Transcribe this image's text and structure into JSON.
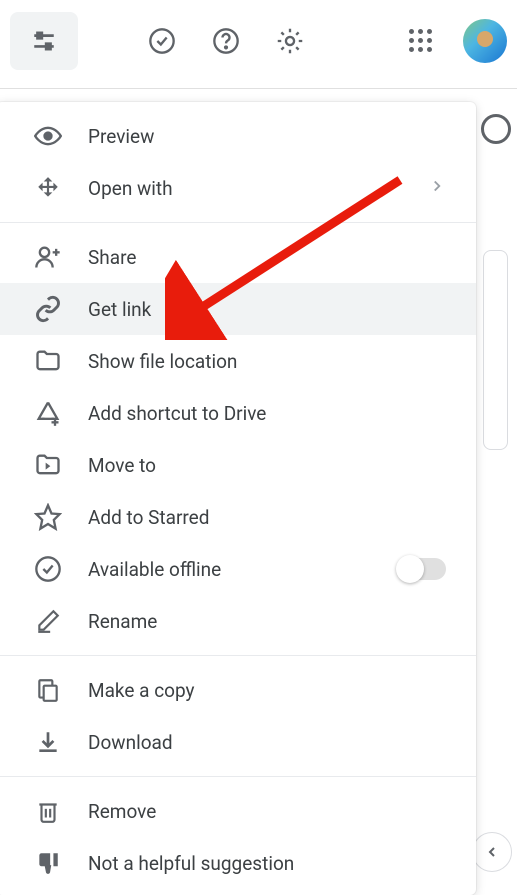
{
  "toolbar": {
    "icons": {
      "tune": "tune-icon",
      "ready": "check-circle-icon",
      "help": "help-icon",
      "settings": "gear-icon",
      "apps": "apps-grid-icon"
    }
  },
  "menu": {
    "preview": "Preview",
    "open_with": "Open with",
    "share": "Share",
    "get_link": "Get link",
    "show_location": "Show file location",
    "add_shortcut": "Add shortcut to Drive",
    "move_to": "Move to",
    "add_starred": "Add to Starred",
    "available_offline": "Available offline",
    "rename": "Rename",
    "make_copy": "Make a copy",
    "download": "Download",
    "remove": "Remove",
    "not_helpful": "Not a helpful suggestion"
  },
  "colors": {
    "arrow": "#e81c0c",
    "text": "#3c4043",
    "icon": "#5f6368",
    "highlight": "#f1f3f4"
  }
}
